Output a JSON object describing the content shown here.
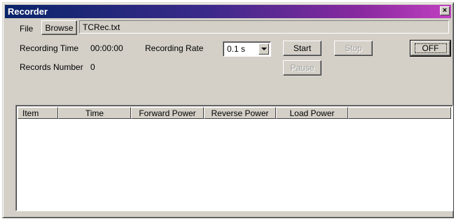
{
  "window": {
    "title": "Recorder",
    "close_label": "×"
  },
  "file": {
    "label": "File",
    "browse_label": "Browse",
    "filename": "TCRec.txt"
  },
  "recording_time": {
    "label": "Recording Time",
    "value": "00:00:00"
  },
  "recording_rate": {
    "label": "Recording Rate",
    "selected": "0.1 s"
  },
  "records_number": {
    "label": "Records Number",
    "value": "0"
  },
  "buttons": {
    "start": "Start",
    "stop": "Stop",
    "pause": "Pause",
    "off": "OFF"
  },
  "table": {
    "columns": [
      "Item",
      "Time",
      "Forward Power",
      "Reverse Power",
      "Load Power"
    ],
    "rows": []
  }
}
